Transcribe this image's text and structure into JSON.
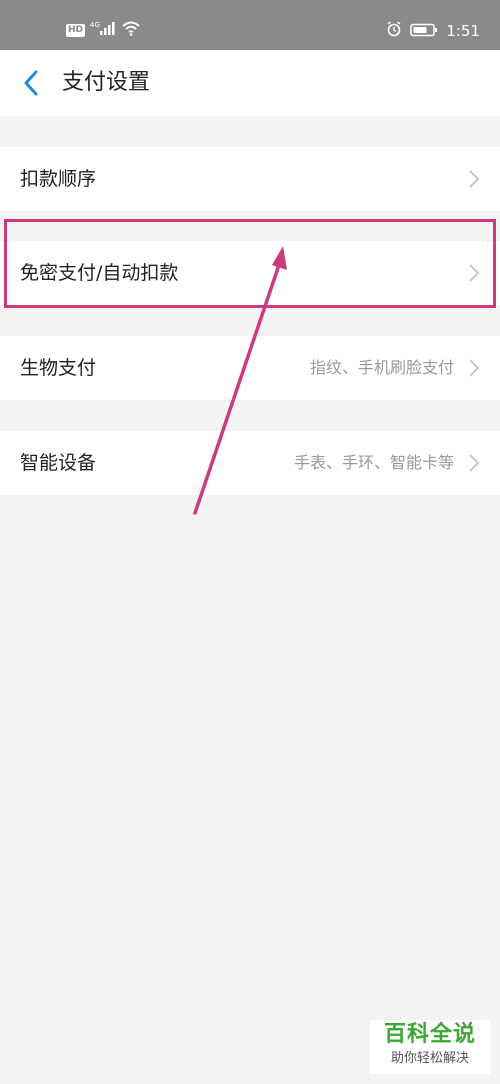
{
  "status_bar": {
    "hd": "HD",
    "network": "4G",
    "time": "1:51",
    "icons": [
      "signal-icon",
      "wifi-icon",
      "alarm-icon",
      "battery-icon"
    ]
  },
  "header": {
    "back_icon": "chevron-left-icon",
    "title": "支付设置",
    "accent_color": "#1a8fd8"
  },
  "settings": {
    "items": [
      {
        "label": "扣款顺序",
        "value": ""
      },
      {
        "label": "免密支付/自动扣款",
        "value": ""
      },
      {
        "label": "生物支付",
        "value": "指纹、手机刷脸支付"
      },
      {
        "label": "智能设备",
        "value": "手表、手环、智能卡等"
      }
    ]
  },
  "annotation": {
    "highlight_color": "#cc3a7e",
    "highlighted_item": "免密支付/自动扣款"
  },
  "watermark": {
    "title": "百科全说",
    "subtitle": "助你轻松解决"
  }
}
